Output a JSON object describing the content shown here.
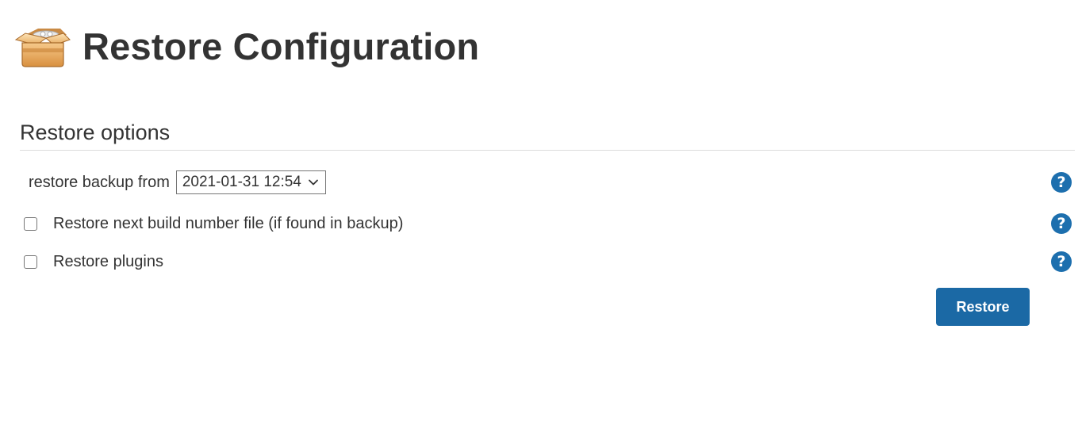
{
  "header": {
    "icon": "box-icon",
    "title": "Restore Configuration"
  },
  "section": {
    "title": "Restore options"
  },
  "backup": {
    "label": "restore backup from",
    "selected": "2021-01-31 12:54"
  },
  "options": {
    "build_number": {
      "label": "Restore next build number file (if found in backup)",
      "checked": false
    },
    "plugins": {
      "label": "Restore plugins",
      "checked": false
    }
  },
  "help": {
    "glyph": "?",
    "icon": "help-icon"
  },
  "actions": {
    "restore_label": "Restore"
  },
  "colors": {
    "accent": "#1b69a5",
    "help": "#1d6fae",
    "text": "#333333"
  }
}
